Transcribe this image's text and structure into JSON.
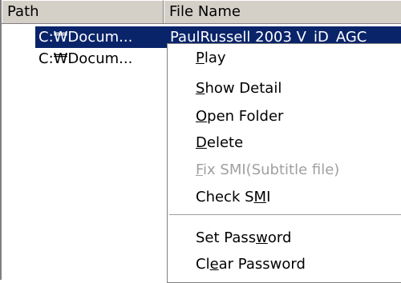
{
  "list": {
    "columns": [
      "Path",
      "File Name"
    ],
    "rows": [
      {
        "path": "C:₩Docum...",
        "file_name": "PaulRussell 2003 V_iD_AGC"
      },
      {
        "path": "C:₩Docum...",
        "file_name": ""
      }
    ]
  },
  "context_menu": {
    "items": [
      {
        "before": "",
        "key": "P",
        "after": "lay",
        "enabled": true
      },
      {
        "before": "",
        "key": "S",
        "after": "how Detail",
        "enabled": true
      },
      {
        "before": "",
        "key": "O",
        "after": "pen Folder",
        "enabled": true
      },
      {
        "before": "",
        "key": "D",
        "after": "elete",
        "enabled": true
      },
      {
        "before": "",
        "key": "F",
        "after": "ix SMI(Subtitle file)",
        "enabled": false
      },
      {
        "before": "Check S",
        "key": "M",
        "after": "I",
        "enabled": true
      },
      {
        "before": "Set Pass",
        "key": "w",
        "after": "ord",
        "enabled": true
      },
      {
        "before": "Cl",
        "key": "e",
        "after": "ar Password",
        "enabled": true
      }
    ]
  },
  "colors": {
    "selection_bg": "#0a246a",
    "header_bg": "#d4d0c8",
    "disabled_text": "#a0a0a0"
  }
}
